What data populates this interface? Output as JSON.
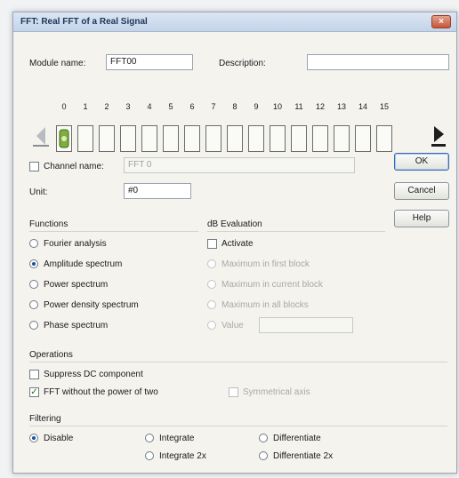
{
  "window": {
    "title": "FFT: Real FFT of a Real Signal",
    "close_glyph": "×"
  },
  "module": {
    "name_label": "Module name:",
    "name_value": "FFT00",
    "description_label": "Description:",
    "description_value": ""
  },
  "channels": {
    "numbers": [
      "0",
      "1",
      "2",
      "3",
      "4",
      "5",
      "6",
      "7",
      "8",
      "9",
      "10",
      "11",
      "12",
      "13",
      "14",
      "15"
    ]
  },
  "channel_name": {
    "label": "Channel name:",
    "value": "FFT 0"
  },
  "unit": {
    "label": "Unit:",
    "value": "#0"
  },
  "buttons": {
    "ok": "OK",
    "cancel": "Cancel",
    "help": "Help"
  },
  "functions": {
    "title": "Functions",
    "options": [
      "Fourier analysis",
      "Amplitude spectrum",
      "Power spectrum",
      "Power density spectrum",
      "Phase spectrum"
    ],
    "selected": "Amplitude spectrum"
  },
  "db_eval": {
    "title": "dB Evaluation",
    "activate_label": "Activate",
    "options": [
      "Maximum in first block",
      "Maximum in current block",
      "Maximum in all blocks",
      "Value"
    ],
    "value_field": ""
  },
  "operations": {
    "title": "Operations",
    "suppress_dc": "Suppress DC component",
    "fft_no_power": "FFT without the power of two",
    "fft_no_power_checked": true,
    "symmetrical_axis": "Symmetrical axis"
  },
  "filtering": {
    "title": "Filtering",
    "options": [
      "Disable",
      "Integrate",
      "Integrate 2x",
      "Differentiate",
      "Differentiate 2x"
    ],
    "selected": "Disable"
  },
  "colors": {
    "accent": "#1b4fa0",
    "title_bg": "#c3d4ea"
  }
}
